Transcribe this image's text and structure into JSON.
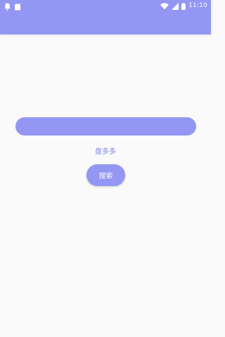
{
  "status_bar": {
    "time": "11:10",
    "icons": [
      "notification-icon",
      "sd-card-icon",
      "wifi-icon",
      "signal-icon",
      "battery-icon"
    ]
  },
  "search": {
    "value": "",
    "placeholder": ""
  },
  "app_label": "盘多多",
  "search_button_label": "搜索",
  "colors": {
    "primary": "#9396f2",
    "label_text": "#8385e6",
    "background": "#fafafa"
  }
}
